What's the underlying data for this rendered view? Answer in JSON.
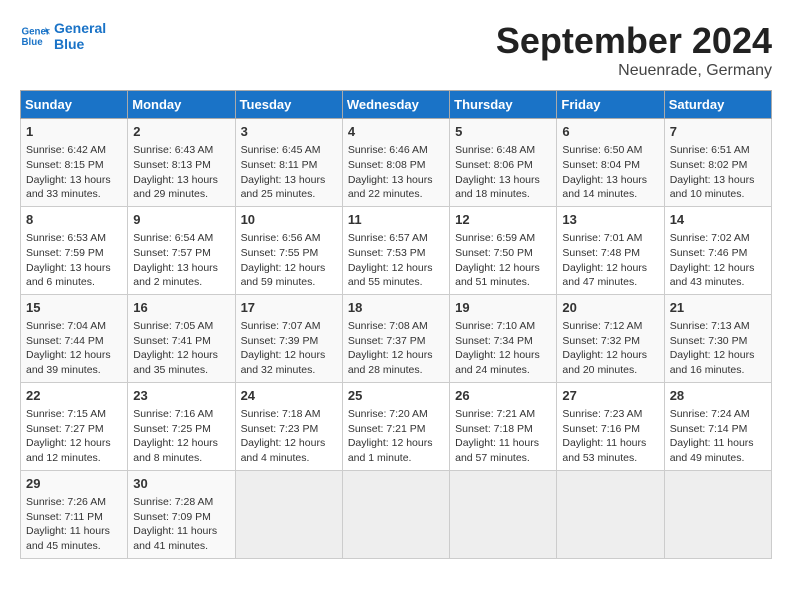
{
  "header": {
    "logo_line1": "General",
    "logo_line2": "Blue",
    "month": "September 2024",
    "location": "Neuenrade, Germany"
  },
  "weekdays": [
    "Sunday",
    "Monday",
    "Tuesday",
    "Wednesday",
    "Thursday",
    "Friday",
    "Saturday"
  ],
  "weeks": [
    [
      {
        "day": "1",
        "info": "Sunrise: 6:42 AM\nSunset: 8:15 PM\nDaylight: 13 hours\nand 33 minutes."
      },
      {
        "day": "2",
        "info": "Sunrise: 6:43 AM\nSunset: 8:13 PM\nDaylight: 13 hours\nand 29 minutes."
      },
      {
        "day": "3",
        "info": "Sunrise: 6:45 AM\nSunset: 8:11 PM\nDaylight: 13 hours\nand 25 minutes."
      },
      {
        "day": "4",
        "info": "Sunrise: 6:46 AM\nSunset: 8:08 PM\nDaylight: 13 hours\nand 22 minutes."
      },
      {
        "day": "5",
        "info": "Sunrise: 6:48 AM\nSunset: 8:06 PM\nDaylight: 13 hours\nand 18 minutes."
      },
      {
        "day": "6",
        "info": "Sunrise: 6:50 AM\nSunset: 8:04 PM\nDaylight: 13 hours\nand 14 minutes."
      },
      {
        "day": "7",
        "info": "Sunrise: 6:51 AM\nSunset: 8:02 PM\nDaylight: 13 hours\nand 10 minutes."
      }
    ],
    [
      {
        "day": "8",
        "info": "Sunrise: 6:53 AM\nSunset: 7:59 PM\nDaylight: 13 hours\nand 6 minutes."
      },
      {
        "day": "9",
        "info": "Sunrise: 6:54 AM\nSunset: 7:57 PM\nDaylight: 13 hours\nand 2 minutes."
      },
      {
        "day": "10",
        "info": "Sunrise: 6:56 AM\nSunset: 7:55 PM\nDaylight: 12 hours\nand 59 minutes."
      },
      {
        "day": "11",
        "info": "Sunrise: 6:57 AM\nSunset: 7:53 PM\nDaylight: 12 hours\nand 55 minutes."
      },
      {
        "day": "12",
        "info": "Sunrise: 6:59 AM\nSunset: 7:50 PM\nDaylight: 12 hours\nand 51 minutes."
      },
      {
        "day": "13",
        "info": "Sunrise: 7:01 AM\nSunset: 7:48 PM\nDaylight: 12 hours\nand 47 minutes."
      },
      {
        "day": "14",
        "info": "Sunrise: 7:02 AM\nSunset: 7:46 PM\nDaylight: 12 hours\nand 43 minutes."
      }
    ],
    [
      {
        "day": "15",
        "info": "Sunrise: 7:04 AM\nSunset: 7:44 PM\nDaylight: 12 hours\nand 39 minutes."
      },
      {
        "day": "16",
        "info": "Sunrise: 7:05 AM\nSunset: 7:41 PM\nDaylight: 12 hours\nand 35 minutes."
      },
      {
        "day": "17",
        "info": "Sunrise: 7:07 AM\nSunset: 7:39 PM\nDaylight: 12 hours\nand 32 minutes."
      },
      {
        "day": "18",
        "info": "Sunrise: 7:08 AM\nSunset: 7:37 PM\nDaylight: 12 hours\nand 28 minutes."
      },
      {
        "day": "19",
        "info": "Sunrise: 7:10 AM\nSunset: 7:34 PM\nDaylight: 12 hours\nand 24 minutes."
      },
      {
        "day": "20",
        "info": "Sunrise: 7:12 AM\nSunset: 7:32 PM\nDaylight: 12 hours\nand 20 minutes."
      },
      {
        "day": "21",
        "info": "Sunrise: 7:13 AM\nSunset: 7:30 PM\nDaylight: 12 hours\nand 16 minutes."
      }
    ],
    [
      {
        "day": "22",
        "info": "Sunrise: 7:15 AM\nSunset: 7:27 PM\nDaylight: 12 hours\nand 12 minutes."
      },
      {
        "day": "23",
        "info": "Sunrise: 7:16 AM\nSunset: 7:25 PM\nDaylight: 12 hours\nand 8 minutes."
      },
      {
        "day": "24",
        "info": "Sunrise: 7:18 AM\nSunset: 7:23 PM\nDaylight: 12 hours\nand 4 minutes."
      },
      {
        "day": "25",
        "info": "Sunrise: 7:20 AM\nSunset: 7:21 PM\nDaylight: 12 hours\nand 1 minute."
      },
      {
        "day": "26",
        "info": "Sunrise: 7:21 AM\nSunset: 7:18 PM\nDaylight: 11 hours\nand 57 minutes."
      },
      {
        "day": "27",
        "info": "Sunrise: 7:23 AM\nSunset: 7:16 PM\nDaylight: 11 hours\nand 53 minutes."
      },
      {
        "day": "28",
        "info": "Sunrise: 7:24 AM\nSunset: 7:14 PM\nDaylight: 11 hours\nand 49 minutes."
      }
    ],
    [
      {
        "day": "29",
        "info": "Sunrise: 7:26 AM\nSunset: 7:11 PM\nDaylight: 11 hours\nand 45 minutes."
      },
      {
        "day": "30",
        "info": "Sunrise: 7:28 AM\nSunset: 7:09 PM\nDaylight: 11 hours\nand 41 minutes."
      },
      {
        "day": "",
        "info": ""
      },
      {
        "day": "",
        "info": ""
      },
      {
        "day": "",
        "info": ""
      },
      {
        "day": "",
        "info": ""
      },
      {
        "day": "",
        "info": ""
      }
    ]
  ]
}
